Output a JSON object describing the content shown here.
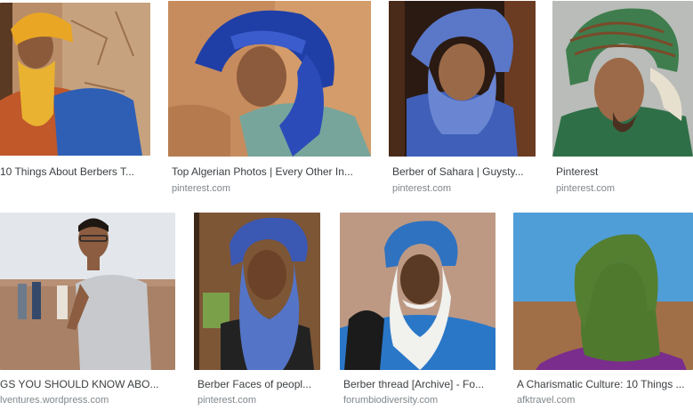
{
  "results": [
    {
      "caption": "10 Things About Berbers T...",
      "source": ""
    },
    {
      "caption": "Top Algerian Photos | Every Other In...",
      "source": "pinterest.com"
    },
    {
      "caption": "Berber of Sahara | Guysty...",
      "source": "pinterest.com"
    },
    {
      "caption": "Pinterest",
      "source": "pinterest.com"
    },
    {
      "caption": "GS YOU SHOULD KNOW ABO...",
      "source": "lventures.wordpress.com"
    },
    {
      "caption": "Berber Faces of peopl...",
      "source": "pinterest.com"
    },
    {
      "caption": "Berber thread [Archive] - Fo...",
      "source": "forumbiodiversity.com"
    },
    {
      "caption": "A Charismatic Culture: 10 Things ...",
      "source": "afktravel.com"
    }
  ],
  "colors": {
    "caption_text": "#3c4043",
    "source_text": "#80868b"
  }
}
